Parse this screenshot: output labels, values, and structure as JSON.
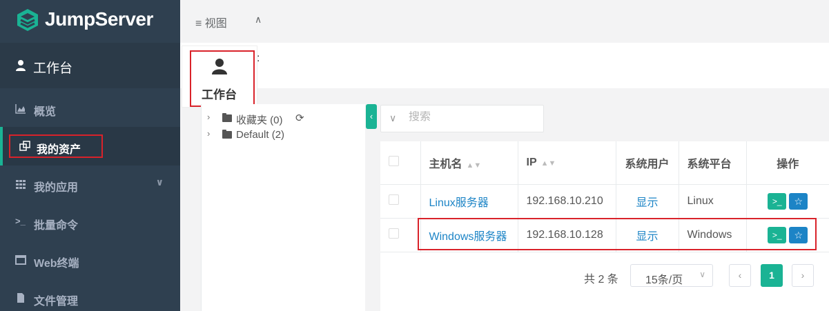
{
  "brand": {
    "name": "JumpServer",
    "accent": "#1ab394",
    "link": "#1c84c6",
    "sidebar_bg": "#2f4050"
  },
  "sidebar": {
    "workspace": {
      "label": "工作台",
      "icon": "user-icon"
    },
    "items": [
      {
        "label": "概览",
        "icon": "area-chart-icon"
      },
      {
        "label": "我的资产",
        "icon": "assets-icon",
        "active": true
      },
      {
        "label": "我的应用",
        "icon": "grid-icon",
        "has_children": true
      },
      {
        "label": "批量命令",
        "icon": "terminal-icon"
      },
      {
        "label": "Web终端",
        "icon": "window-icon"
      },
      {
        "label": "文件管理",
        "icon": "file-icon"
      }
    ]
  },
  "topbar": {
    "view_label": "视图",
    "view_icon": "menu-icon"
  },
  "popup": {
    "label": "工作台",
    "icon": "user-icon"
  },
  "header": {
    "colon": ":"
  },
  "tree": {
    "nodes": [
      {
        "label": "收藏夹 (0)",
        "icon": "folder-icon",
        "refresh_icon": "refresh-icon"
      },
      {
        "label": "Default (2)",
        "icon": "folder-icon"
      }
    ]
  },
  "search": {
    "placeholder": "搜索"
  },
  "table": {
    "headers": {
      "host": "主机名",
      "ip": "IP",
      "system_user": "系统用户",
      "platform": "系统平台",
      "actions": "操作"
    },
    "rows": [
      {
        "host": "Linux服务器",
        "ip": "192.168.10.210",
        "system_user": "显示",
        "platform": "Linux"
      },
      {
        "host": "Windows服务器",
        "ip": "192.168.10.128",
        "system_user": "显示",
        "platform": "Windows"
      }
    ]
  },
  "pagination": {
    "total": "共 2 条",
    "page_size": "15条/页",
    "current": "1"
  }
}
